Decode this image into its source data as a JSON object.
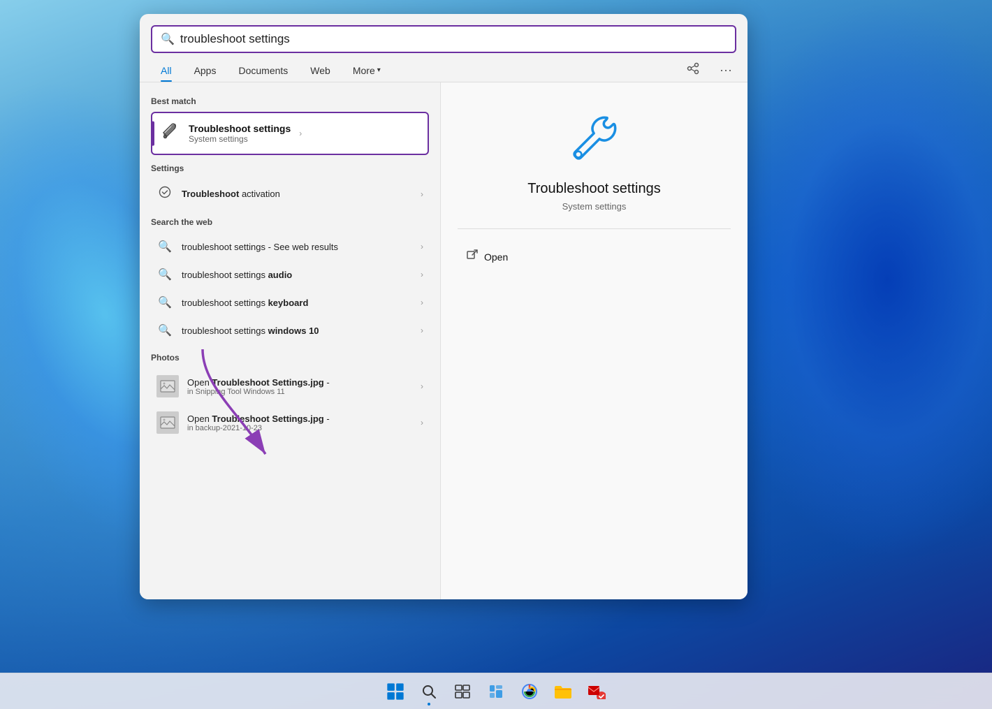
{
  "background": {
    "colors": [
      "#87ceeb",
      "#4a9fd4",
      "#0d47a1"
    ]
  },
  "searchbar": {
    "query": "troubleshoot settings",
    "icon": "🔍"
  },
  "tabs": {
    "items": [
      {
        "label": "All",
        "active": true
      },
      {
        "label": "Apps",
        "active": false
      },
      {
        "label": "Documents",
        "active": false
      },
      {
        "label": "Web",
        "active": false
      },
      {
        "label": "More",
        "active": false,
        "has_chevron": true
      }
    ],
    "more_icon": "⋯",
    "share_icon": "⇄"
  },
  "results": {
    "best_match_label": "Best match",
    "best_match": {
      "title": "Troubleshoot settings",
      "subtitle": "System settings",
      "icon": "wrench"
    },
    "settings_label": "Settings",
    "settings_items": [
      {
        "icon": "circle-check",
        "text_prefix": "Troubleshoot",
        "text_suffix": " activation",
        "bold_prefix": true
      }
    ],
    "web_label": "Search the web",
    "web_items": [
      {
        "text_prefix": "troubleshoot settings",
        "text_suffix": " - See web results",
        "bold_prefix": false
      },
      {
        "text_prefix": "troubleshoot settings ",
        "text_bold": "audio",
        "bold_suffix": true
      },
      {
        "text_prefix": "troubleshoot settings ",
        "text_bold": "keyboard",
        "bold_suffix": true
      },
      {
        "text_prefix": "troubleshoot settings ",
        "text_bold": "windows 10",
        "bold_suffix": true
      }
    ],
    "photos_label": "Photos",
    "photos_items": [
      {
        "text_prefix": "Open ",
        "text_bold": "Troubleshoot Settings.jpg",
        "text_suffix": " -",
        "sub": "in Snipping Tool Windows 11"
      },
      {
        "text_prefix": "Open ",
        "text_bold": "Troubleshoot Settings.jpg",
        "text_suffix": " -",
        "sub": "in backup-2021-10-23"
      }
    ]
  },
  "detail_panel": {
    "title": "Troubleshoot settings",
    "subtitle": "System settings",
    "open_label": "Open",
    "icon_color": "#1a8fe3"
  },
  "taskbar": {
    "items": [
      {
        "name": "start",
        "icon": "windows",
        "active": false
      },
      {
        "name": "search",
        "icon": "search",
        "active": true
      },
      {
        "name": "task-view",
        "icon": "taskview",
        "active": false
      },
      {
        "name": "widgets",
        "icon": "widgets",
        "active": false
      },
      {
        "name": "chrome",
        "icon": "chrome",
        "active": false
      },
      {
        "name": "explorer",
        "icon": "explorer",
        "active": false
      },
      {
        "name": "mail",
        "icon": "mail",
        "active": false
      }
    ]
  }
}
